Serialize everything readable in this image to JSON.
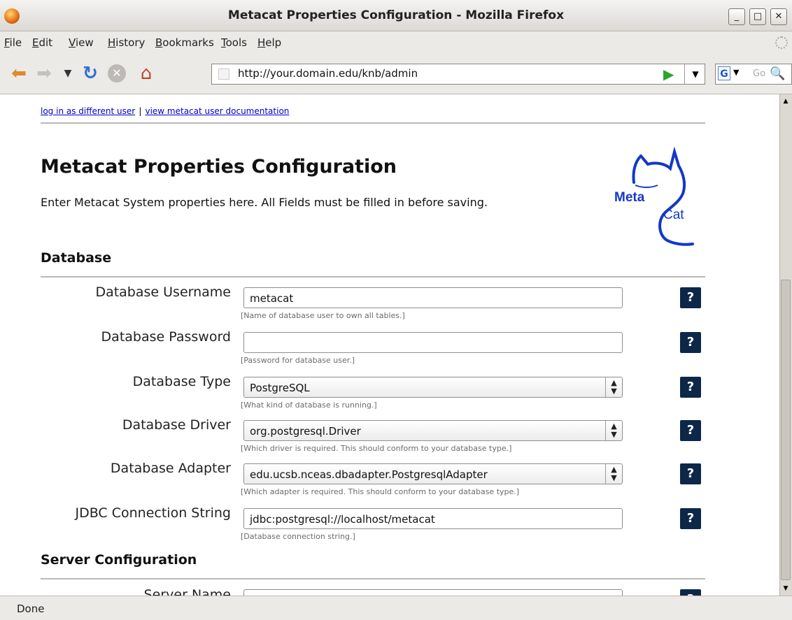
{
  "window": {
    "title": "Metacat Properties Configuration - Mozilla Firefox"
  },
  "menu": [
    "File",
    "Edit",
    "View",
    "History",
    "Bookmarks",
    "Tools",
    "Help"
  ],
  "nav": {
    "url": "http://your.domain.edu/knb/admin",
    "search_placeholder": "Go"
  },
  "status": {
    "text": "Done"
  },
  "page": {
    "links": {
      "login": "log in as different user",
      "separator": "|",
      "docs": "view metacat user documentation"
    },
    "title": "Metacat Properties Configuration",
    "intro": "Enter Metacat System properties here. All Fields must be filled in before saving.",
    "logo": {
      "meta": "Meta",
      "cat": "Cat"
    },
    "sections": {
      "database": "Database",
      "server": "Server Configuration"
    },
    "fields": [
      {
        "label": "Database Username",
        "value": "metacat",
        "hint": "[Name of database user to own all tables.]"
      },
      {
        "label": "Database Password",
        "value": "",
        "hint": "[Password for database user.]"
      },
      {
        "label": "Database Type",
        "value": "PostgreSQL",
        "hint": "[What kind of database is running.]"
      },
      {
        "label": "Database Driver",
        "value": "org.postgresql.Driver",
        "hint": "[Which driver is required. This should conform to your database type.]"
      },
      {
        "label": "Database Adapter",
        "value": "edu.ucsb.nceas.dbadapter.PostgresqlAdapter",
        "hint": "[Which adapter is required. This should conform to your database type.]"
      },
      {
        "label": "JDBC Connection String",
        "value": "jdbc:postgresql://localhost/metacat",
        "hint": "[Database connection string.]"
      }
    ],
    "server_field": {
      "label": "Server Name"
    },
    "help_symbol": "?"
  },
  "colors": {
    "help_bg": "#0d2749",
    "link": "#0000cc",
    "logo": "#1238c8"
  }
}
